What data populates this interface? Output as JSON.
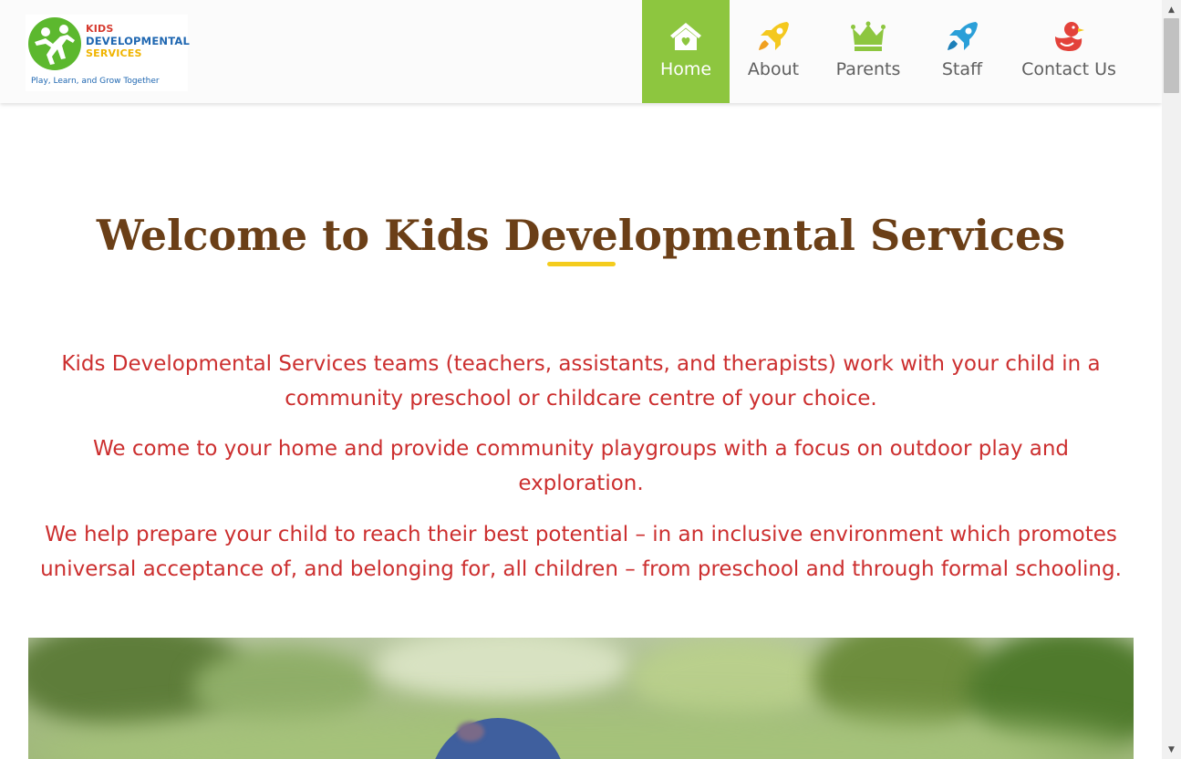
{
  "logo": {
    "line1": "KIDS",
    "line2": "DEVELOPMENTAL",
    "line3": "SERVICES",
    "tagline": "Play, Learn, and Grow Together",
    "icon": "kids-logo-icon"
  },
  "nav": {
    "items": [
      {
        "label": "Home",
        "icon": "house-heart-icon",
        "active": true
      },
      {
        "label": "About",
        "icon": "rocket-icon"
      },
      {
        "label": "Parents",
        "icon": "crown-icon"
      },
      {
        "label": "Staff",
        "icon": "rocket-icon"
      },
      {
        "label": "Contact Us",
        "icon": "rubber-duck-icon"
      }
    ]
  },
  "main": {
    "title": "Welcome to Kids Developmental Services",
    "paragraphs": [
      "Kids Developmental Services teams (teachers, assistants, and therapists) work with your child in a community preschool or childcare centre of your choice.",
      "We come to your home and provide community playgroups with a focus on outdoor play and exploration.",
      "We help prepare your child to reach their best potential – in an inclusive environment which promotes universal acceptance of, and belonging for, all children – from preschool and through formal schooling."
    ]
  },
  "colors": {
    "nav_active": "#8dc63f",
    "title": "#6b3f17",
    "accent_underline": "#f4cc1d",
    "paragraph": "#cc2f2f",
    "icon_yellow": "#f4c81e",
    "icon_green": "#8dc63f",
    "icon_blue": "#2a9fd8",
    "icon_red": "#e3423a"
  },
  "scrollbar": {
    "up": "▲",
    "down": "▼"
  }
}
